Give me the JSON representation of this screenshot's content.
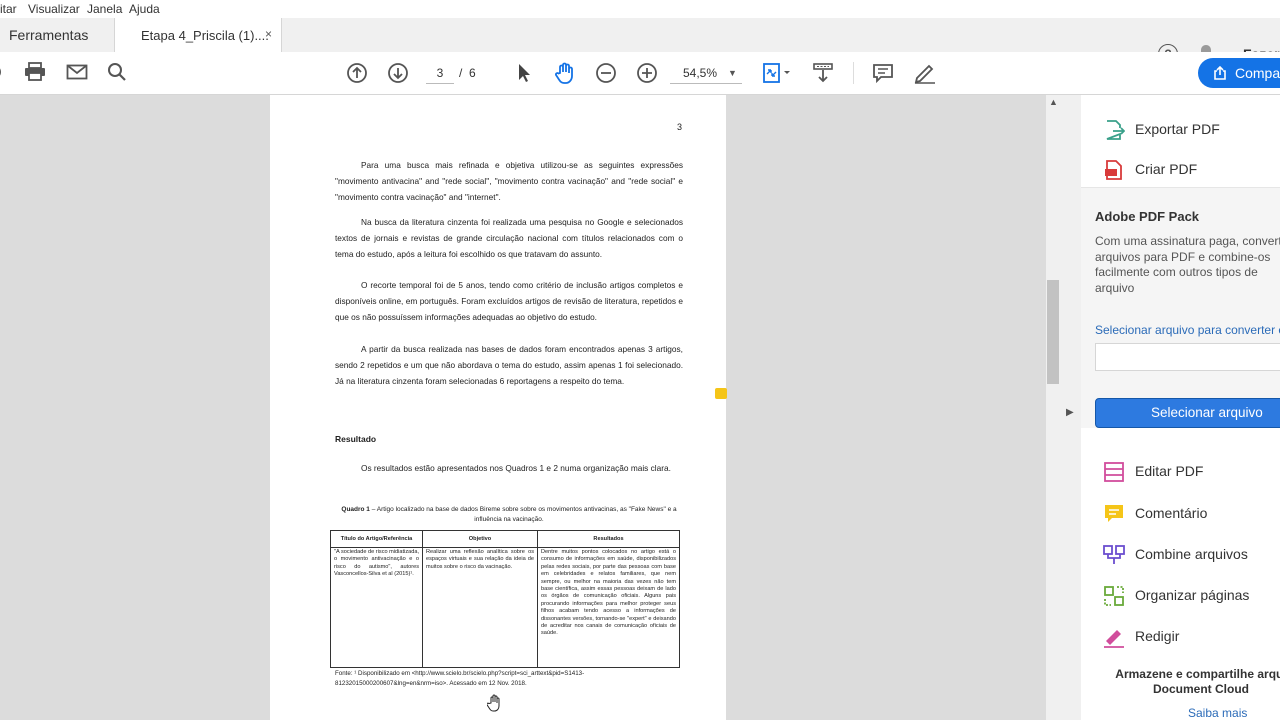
{
  "menu": [
    "itar",
    "Visualizar",
    "Janela",
    "Ajuda"
  ],
  "tabs": {
    "tools": "Ferramentas",
    "document": "Etapa 4_Priscila (1)....",
    "close": "×"
  },
  "header": {
    "fazer": "Fazer"
  },
  "toolbar": {
    "page_current": "3",
    "page_sep": "/",
    "page_total": "6",
    "zoom": "54,5%",
    "share_label": "Compa"
  },
  "document": {
    "page_number": "3",
    "p1": "Para uma busca mais refinada e objetiva utilizou-se as seguintes expressões \"movimento antivacina\" and \"rede social\", \"movimento contra vacinação\" and \"rede social\" e \"movimento contra vacinação\" and \"internet\".",
    "p2": "Na busca da literatura cinzenta foi realizada uma pesquisa no Google e selecionados textos de jornais e revistas de grande circulação nacional com títulos relacionados com o tema do estudo, após a leitura foi escolhido os que tratavam do assunto.",
    "p3": "O recorte temporal foi de 5 anos, tendo como critério de inclusão artigos completos e disponíveis online, em português. Foram excluídos artigos de revisão de literatura, repetidos e que os não possuíssem informações adequadas ao objetivo do estudo.",
    "p4": "A partir da busca realizada nas bases de dados foram encontrados apenas 3 artigos, sendo 2 repetidos e um que não abordava o tema do estudo, assim apenas 1 foi selecionado. Já na literatura cinzenta foram selecionadas 6 reportagens a respeito do tema.",
    "heading": "Resultado",
    "p5": "Os resultados estão apresentados nos Quadros 1 e 2 numa organização mais clara.",
    "quadro_label": "Quadro 1",
    "quadro_caption": " – Artigo localizado na base de dados Bireme sobre sobre os movimentos antivacinas, as \"Fake News\" e a influência na vacinação.",
    "table": {
      "headers": [
        "Título do Artigo/Referência",
        "Objetivo",
        "Resultados"
      ],
      "row": [
        "\"A sociedade de risco midiatizada, o movimento antivacinação e o risco do autismo\", autores Vasconcellos-Silva et al (2015)¹.",
        "Realizar uma reflexão analítica sobre os espaços virtuais e sua relação da ideia de muitos sobre o risco da vacinação.",
        "Dentre muitos pontos colocados no artigo está o consumo de informações em saúde, disponibilizados pelas redes sociais, por parte das pessoas com base em celebridades e relatos familiares, que nem sempre, ou melhor na maioria das vezes não tem base científica, assim essas pessoas deixam de lado os órgãos de comunicação oficiais. Alguns pais procurando informações para melhor proteger seus filhos acabam tendo acesso a informações de dissonantes versões, tornando-se \"expert\" e deixando de acreditar nos canais de comunicação oficiais de saúde."
      ]
    },
    "fonte": "Fonte: ¹ Disponibilizado em <http://www.scielo.br/scielo.php?script=sci_arttext&pid=S1413-81232015000200607&lng=en&nrm=iso>. Acessado em 12 Nov. 2018."
  },
  "right_pane": {
    "export_pdf": "Exportar PDF",
    "create_pdf": "Criar PDF",
    "pack_title": "Adobe PDF Pack",
    "pack_desc": "Com uma assinatura paga, converta arquivos para PDF e combine-os facilmente com outros tipos de arquivo",
    "select_convert": "Selecionar arquivo para converter e",
    "select_button": "Selecionar arquivo",
    "tools": [
      "Editar PDF",
      "Comentário",
      "Combine arquivos",
      "Organizar páginas",
      "Redigir"
    ],
    "store_text": "Armazene e compartilhe arqui Document Cloud",
    "learn_more": "Saiba mais"
  },
  "colors": {
    "accent": "#1473e6",
    "sticky_note": "#f5c518"
  }
}
